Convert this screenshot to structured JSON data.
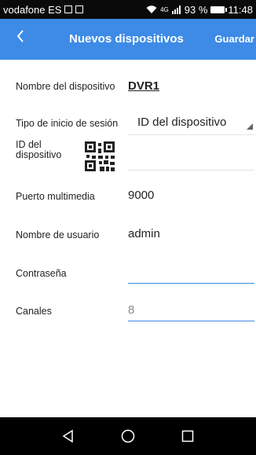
{
  "status_bar": {
    "carrier": "vodafone ES",
    "network": "4G",
    "battery": "93 %",
    "time": "11:48"
  },
  "toolbar": {
    "title": "Nuevos dispositivos",
    "save_label": "Guardar"
  },
  "form": {
    "device_name": {
      "label": "Nombre del dispositivo",
      "value": "DVR1"
    },
    "login_type": {
      "label": "Tipo de inicio de sesión",
      "value": "ID del dispositivo"
    },
    "device_id": {
      "label": "ID del dispositivo",
      "value": ""
    },
    "media_port": {
      "label": "Puerto multimedia",
      "value": "9000"
    },
    "username": {
      "label": "Nombre de usuario",
      "value": "admin"
    },
    "password": {
      "label": "Contraseña",
      "value": ""
    },
    "channels": {
      "label": "Canales",
      "value": "8"
    }
  },
  "colors": {
    "accent": "#3d8be6",
    "status_bar_bg": "#0a0a0a",
    "nav_bar_bg": "#000000"
  }
}
